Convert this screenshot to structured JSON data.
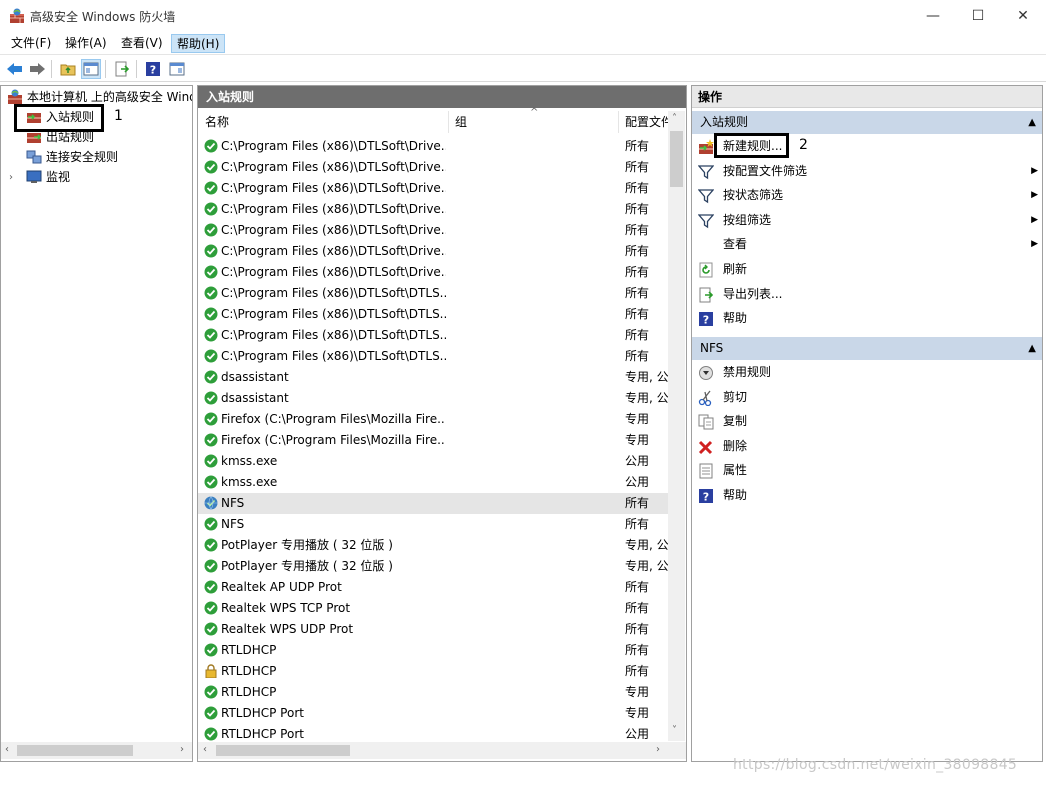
{
  "window": {
    "title": "高级安全 Windows 防火墙",
    "minimize_glyph": "—",
    "maximize_glyph": "☐",
    "close_glyph": "✕"
  },
  "menu": [
    "文件(F)",
    "操作(A)",
    "查看(V)",
    "帮助(H)"
  ],
  "tree": {
    "root": "本地计算机 上的高级安全 Windows",
    "items": [
      "入站规则",
      "出站规则",
      "连接安全规则",
      "监视"
    ]
  },
  "list": {
    "header": "入站规则",
    "columns": [
      "名称",
      "组",
      "配置文件"
    ],
    "rows": [
      {
        "name": "C:\\Program Files (x86)\\DTLSoft\\Drive...",
        "profile": "所有",
        "icon": "check"
      },
      {
        "name": "C:\\Program Files (x86)\\DTLSoft\\Drive...",
        "profile": "所有",
        "icon": "check"
      },
      {
        "name": "C:\\Program Files (x86)\\DTLSoft\\Drive...",
        "profile": "所有",
        "icon": "check"
      },
      {
        "name": "C:\\Program Files (x86)\\DTLSoft\\Drive...",
        "profile": "所有",
        "icon": "check"
      },
      {
        "name": "C:\\Program Files (x86)\\DTLSoft\\Drive...",
        "profile": "所有",
        "icon": "check"
      },
      {
        "name": "C:\\Program Files (x86)\\DTLSoft\\Drive...",
        "profile": "所有",
        "icon": "check"
      },
      {
        "name": "C:\\Program Files (x86)\\DTLSoft\\Drive...",
        "profile": "所有",
        "icon": "check"
      },
      {
        "name": "C:\\Program Files (x86)\\DTLSoft\\DTLS...",
        "profile": "所有",
        "icon": "check"
      },
      {
        "name": "C:\\Program Files (x86)\\DTLSoft\\DTLS...",
        "profile": "所有",
        "icon": "check"
      },
      {
        "name": "C:\\Program Files (x86)\\DTLSoft\\DTLS...",
        "profile": "所有",
        "icon": "check"
      },
      {
        "name": "C:\\Program Files (x86)\\DTLSoft\\DTLS...",
        "profile": "所有",
        "icon": "check"
      },
      {
        "name": "dsassistant",
        "profile": "专用, 公",
        "icon": "check"
      },
      {
        "name": "dsassistant",
        "profile": "专用, 公",
        "icon": "check"
      },
      {
        "name": "Firefox (C:\\Program Files\\Mozilla Fire...",
        "profile": "专用",
        "icon": "check"
      },
      {
        "name": "Firefox (C:\\Program Files\\Mozilla Fire...",
        "profile": "专用",
        "icon": "check"
      },
      {
        "name": "kmss.exe",
        "profile": "公用",
        "icon": "check"
      },
      {
        "name": "kmss.exe",
        "profile": "公用",
        "icon": "check"
      },
      {
        "name": "NFS",
        "profile": "所有",
        "icon": "globe"
      },
      {
        "name": "NFS",
        "profile": "所有",
        "icon": "check"
      },
      {
        "name": "PotPlayer 专用播放 ( 32 位版 )",
        "profile": "专用, 公",
        "icon": "check"
      },
      {
        "name": "PotPlayer 专用播放 ( 32 位版 )",
        "profile": "专用, 公",
        "icon": "check"
      },
      {
        "name": "Realtek AP UDP Prot",
        "profile": "所有",
        "icon": "check"
      },
      {
        "name": "Realtek WPS TCP Prot",
        "profile": "所有",
        "icon": "check"
      },
      {
        "name": "Realtek WPS UDP Prot",
        "profile": "所有",
        "icon": "check"
      },
      {
        "name": "RTLDHCP",
        "profile": "所有",
        "icon": "check"
      },
      {
        "name": "RTLDHCP",
        "profile": "所有",
        "icon": "lock"
      },
      {
        "name": "RTLDHCP",
        "profile": "专用",
        "icon": "check"
      },
      {
        "name": "RTLDHCP Port",
        "profile": "专用",
        "icon": "check"
      },
      {
        "name": "RTLDHCP Port",
        "profile": "公用",
        "icon": "check"
      }
    ]
  },
  "actions": {
    "header": "操作",
    "section1": {
      "title": "入站规则",
      "items": [
        {
          "label": "新建规则...",
          "icon": "new-rule-icon",
          "submenu": false
        },
        {
          "label": "按配置文件筛选",
          "icon": "filter-icon",
          "submenu": true
        },
        {
          "label": "按状态筛选",
          "icon": "filter-icon",
          "submenu": true
        },
        {
          "label": "按组筛选",
          "icon": "filter-icon",
          "submenu": true
        },
        {
          "label": "查看",
          "icon": "",
          "submenu": true
        },
        {
          "label": "刷新",
          "icon": "refresh-icon",
          "submenu": false
        },
        {
          "label": "导出列表...",
          "icon": "export-icon",
          "submenu": false
        },
        {
          "label": "帮助",
          "icon": "help-icon",
          "submenu": false
        }
      ]
    },
    "section2": {
      "title": "NFS",
      "items": [
        {
          "label": "禁用规则",
          "icon": "disable-icon"
        },
        {
          "label": "剪切",
          "icon": "cut-icon"
        },
        {
          "label": "复制",
          "icon": "copy-icon"
        },
        {
          "label": "删除",
          "icon": "delete-icon"
        },
        {
          "label": "属性",
          "icon": "properties-icon"
        },
        {
          "label": "帮助",
          "icon": "help-icon"
        }
      ]
    }
  },
  "annotations": {
    "callout1": "1",
    "callout2": "2"
  },
  "watermark": "https://blog.csdn.net/weixin_38098845",
  "colors": {
    "list_header_bg": "#6e6e6e",
    "section_bg": "#c9d7e8",
    "check_green": "#2e9e3a",
    "selected_row": "#e5e5e5"
  }
}
